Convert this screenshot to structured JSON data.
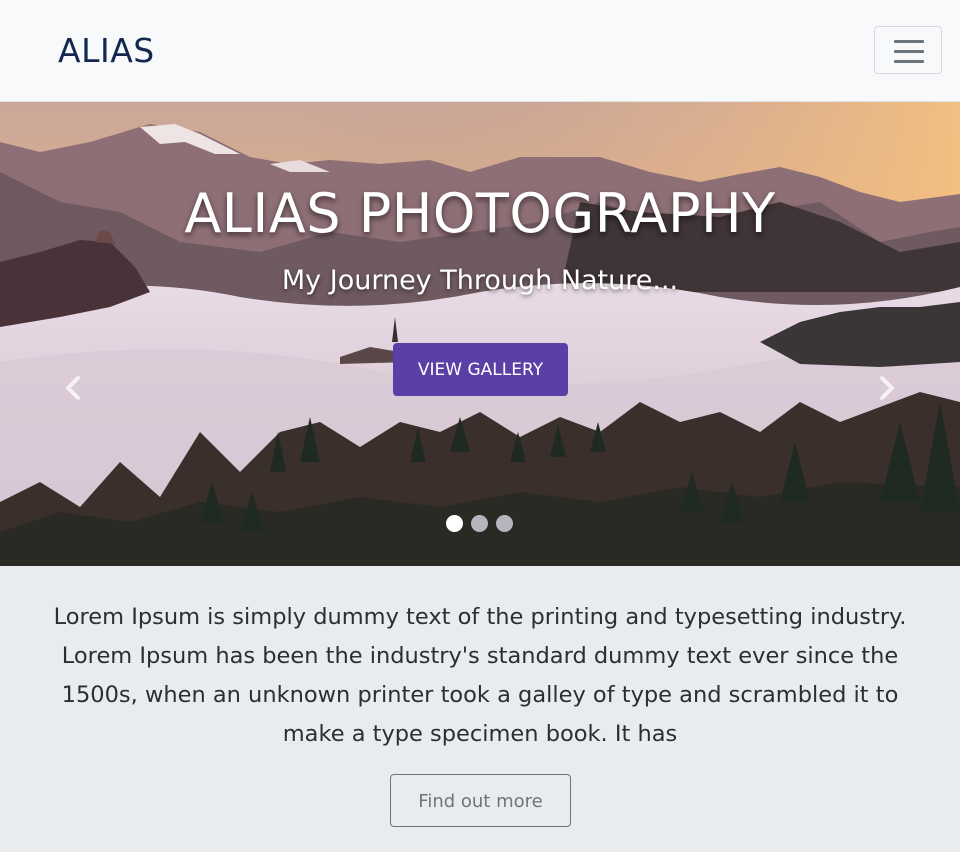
{
  "navbar": {
    "brand": "ALIAS",
    "toggler_icon": "hamburger-menu-icon"
  },
  "hero": {
    "title": "ALIAS PHOTOGRAPHY",
    "subtitle": "My Journey Through Nature...",
    "button_label": "VIEW GALLERY",
    "prev_icon": "chevron-left-icon",
    "next_icon": "chevron-right-icon",
    "slides_count": 3,
    "active_slide": 1,
    "colors": {
      "button": "#5c3fa6",
      "dot_active": "#ffffff",
      "dot_inactive": "#b8b4bd"
    }
  },
  "content": {
    "paragraph": "Lorem Ipsum is simply dummy text of the printing and typesetting industry. Lorem Ipsum has been the industry's standard dummy text ever since the 1500s, when an unknown printer took a galley of type and scrambled it to make a type specimen book. It has",
    "button_label": "Find out more"
  }
}
